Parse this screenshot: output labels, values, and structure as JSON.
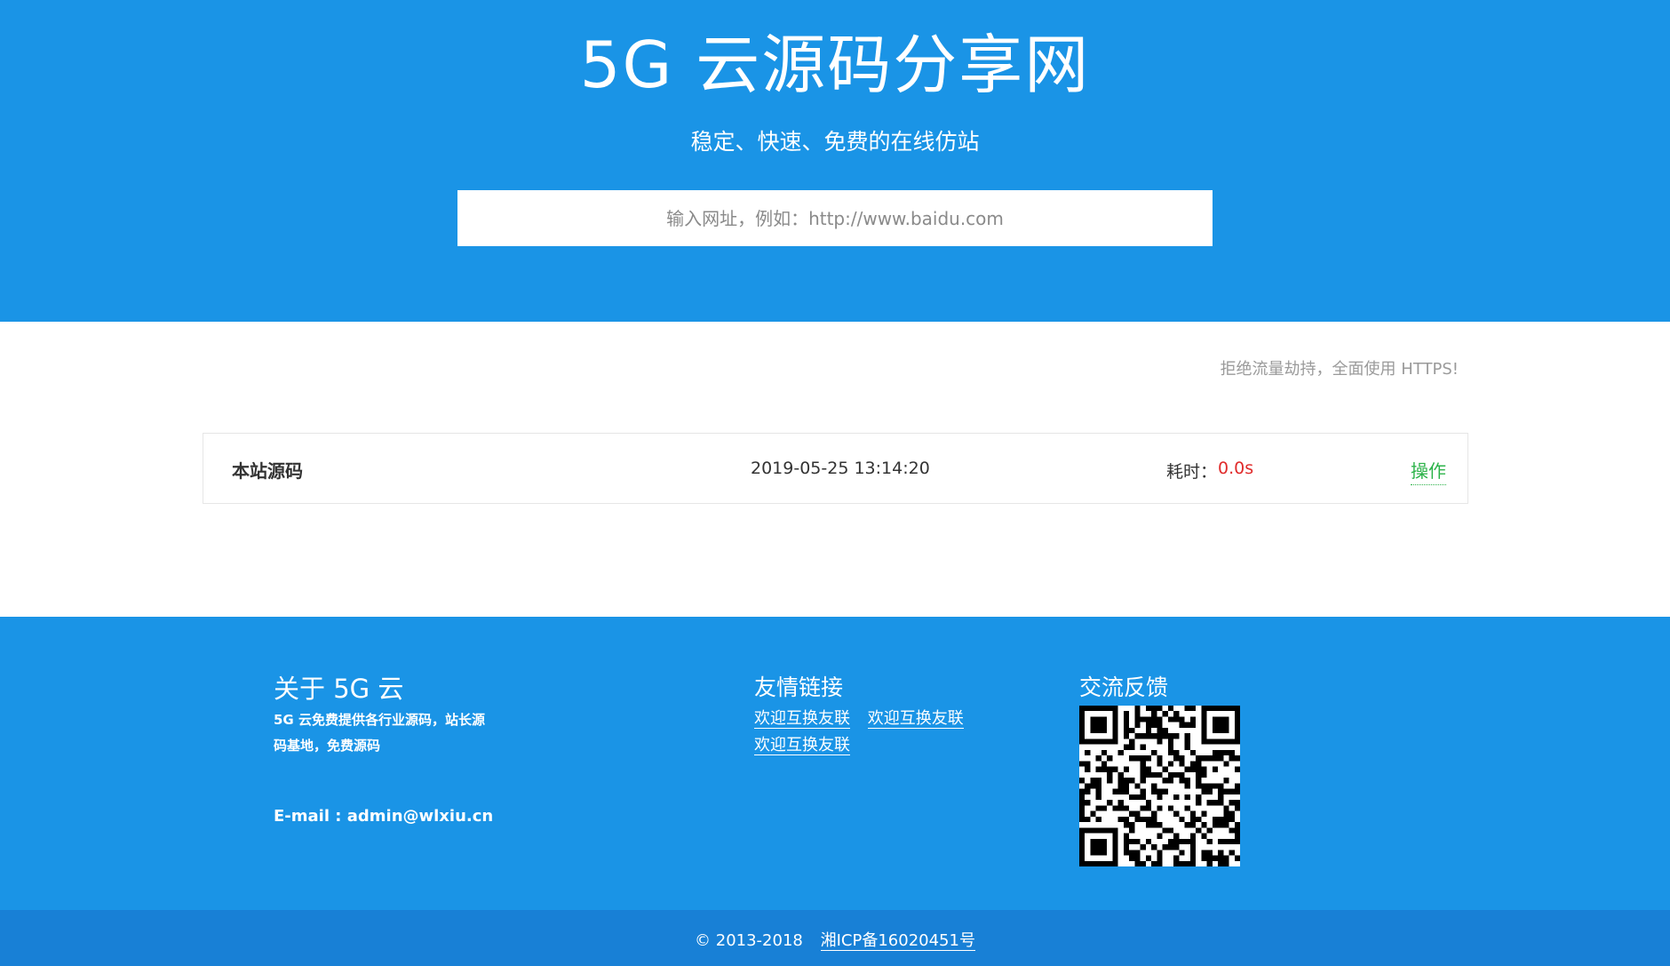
{
  "hero": {
    "title": "5G 云源码分享网",
    "subtitle": "稳定、快速、免费的在线仿站",
    "search_placeholder": "输入网址，例如：http://www.baidu.com",
    "search_value": ""
  },
  "notice": "拒绝流量劫持，全面使用 HTTPS!",
  "record": {
    "name": "本站源码",
    "date": "2019-05-25 13:14:20",
    "time_label": "耗时：",
    "time_value": "0.0s",
    "action_label": "操作"
  },
  "footer": {
    "about": {
      "title": "关于 5G 云",
      "text": "5G 云免费提供各行业源码，站长源码基地，免费源码",
      "email": "E-mail : admin@wlxiu.cn"
    },
    "links": {
      "title": "友情链接",
      "items": [
        "欢迎互换友联",
        "欢迎互换友联",
        "欢迎互换友联"
      ]
    },
    "feedback": {
      "title": "交流反馈"
    }
  },
  "bottom": {
    "copyright": "© 2013-2018",
    "icp": "湘ICP备16020451号"
  },
  "colors": {
    "primary": "#1a94e6",
    "bottom_bar": "#1880d6",
    "time_value": "#e02b2b",
    "action": "#2db34a"
  }
}
